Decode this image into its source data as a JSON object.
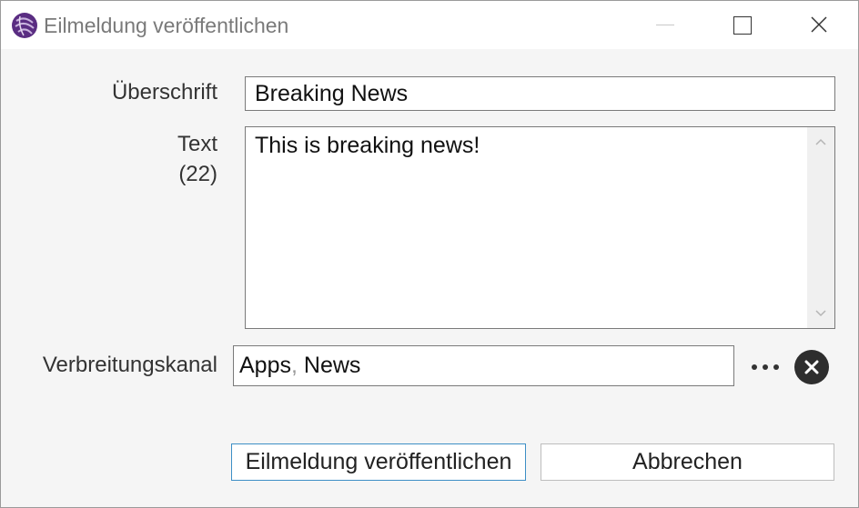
{
  "window": {
    "title": "Eilmeldung veröffentlichen",
    "icon": "app-logo-icon",
    "accent": "#5a2d82",
    "controls": [
      "minimize-icon",
      "maximize-icon",
      "close-icon"
    ]
  },
  "form": {
    "headline": {
      "label": "Überschrift",
      "value": "Breaking News"
    },
    "text": {
      "label": "Text",
      "count": "(22)",
      "value": "This is breaking news!"
    },
    "channel": {
      "label": "Verbreitungskanal",
      "values": [
        "Apps",
        "News"
      ],
      "separator": ", ",
      "more_icon": "more-dots-icon",
      "clear_icon": "clear-circle-icon"
    }
  },
  "buttons": {
    "publish": "Eilmeldung veröffentlichen",
    "cancel": "Abbrechen"
  }
}
